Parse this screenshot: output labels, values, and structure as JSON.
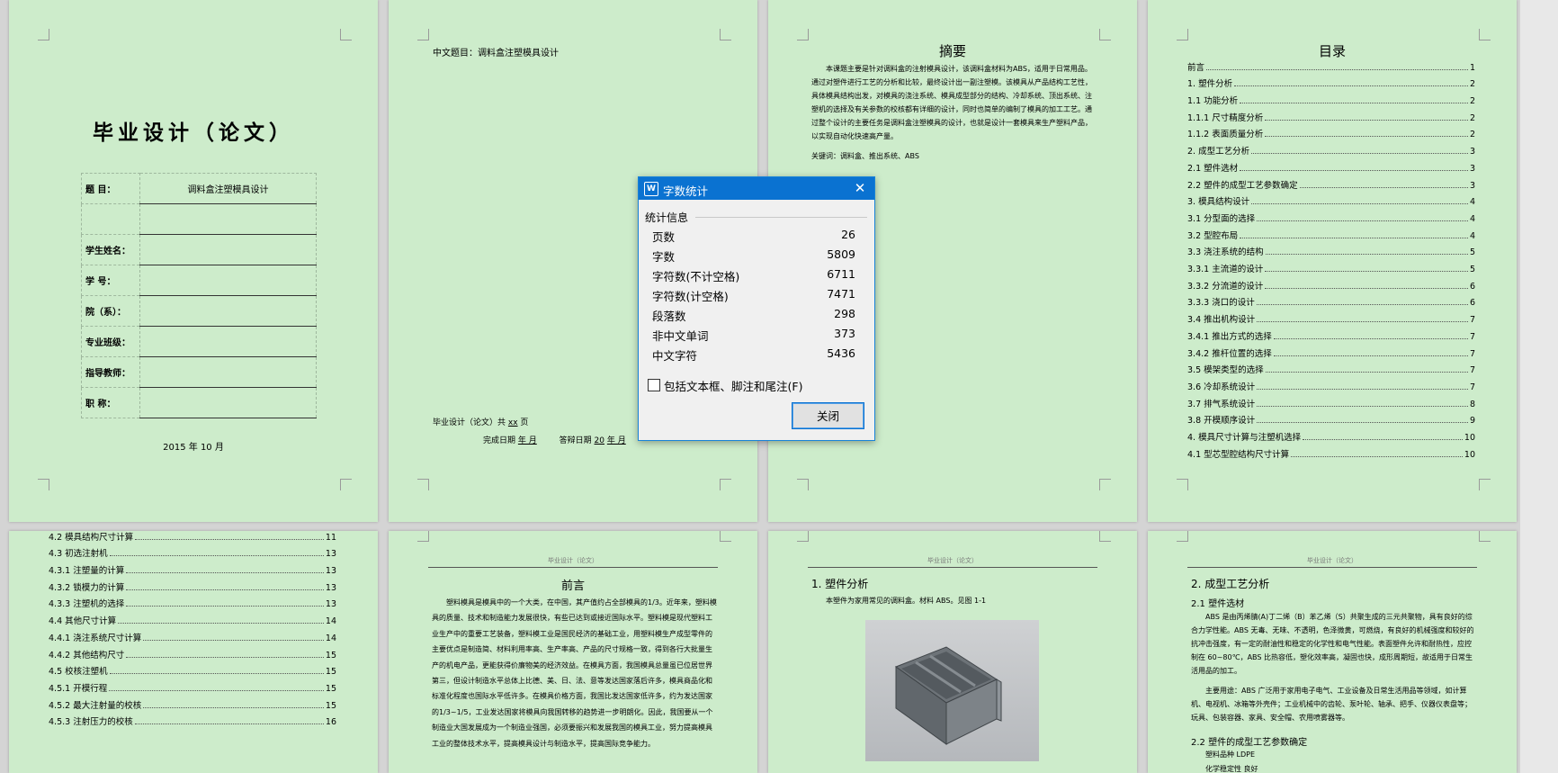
{
  "cover": {
    "title": "毕业设计（论文）",
    "rows": [
      {
        "label": "题    目：",
        "value": "调料盒注塑模具设计"
      },
      {
        "label": "",
        "value": ""
      },
      {
        "label": "学生姓名：",
        "value": ""
      },
      {
        "label": "学    号：",
        "value": ""
      },
      {
        "label": "院（系）：",
        "value": ""
      },
      {
        "label": "专业班级：",
        "value": ""
      },
      {
        "label": "指导教师：",
        "value": ""
      },
      {
        "label": "职    称：",
        "value": ""
      }
    ],
    "date": "2015 年 10 月"
  },
  "page2": {
    "subject": "中文题目：调料盒注塑模具设计",
    "total_prefix": "毕业设计（论文）共",
    "total_blank": "xx",
    "total_suffix": "页",
    "complete_prefix": "完成日期",
    "complete_month": "年  月",
    "defense_prefix": "答辩日期",
    "defense_year": "20",
    "defense_rest": "年  月"
  },
  "abstract": {
    "title": "摘要",
    "body": "本课题主要是针对调料盒的注射模具设计，该调料盒材料为ABS，适用于日常用品。通过对塑件进行工艺的分析和比较，最终设计出一副注塑模。该模具从产品结构工艺性，具体模具结构出发，对模具的浇注系统、模具成型部分的结构、冷却系统、顶出系统、注塑机的选择及有关参数的校核都有详细的设计，同时也简单的编制了模具的加工工艺。通过整个设计的主要任务是调料盒注塑模具的设计，也就是设计一套模具来生产塑料产品，以实现自动化快速高产量。",
    "keywords": "关键词：调料盒、推出系统、ABS"
  },
  "toc": {
    "title": "目录",
    "items": [
      {
        "t": "前言",
        "n": "1"
      },
      {
        "t": "1. 塑件分析",
        "n": "2"
      },
      {
        "t": "1.1 功能分析",
        "n": "2"
      },
      {
        "t": "1.1.1 尺寸精度分析",
        "n": "2"
      },
      {
        "t": "1.1.2 表面质量分析",
        "n": "2"
      },
      {
        "t": "2. 成型工艺分析",
        "n": "3"
      },
      {
        "t": "2.1 塑件选材",
        "n": "3"
      },
      {
        "t": "2.2 塑件的成型工艺参数确定",
        "n": "3"
      },
      {
        "t": "3. 模具结构设计",
        "n": "4"
      },
      {
        "t": "3.1 分型面的选择",
        "n": "4"
      },
      {
        "t": "3.2 型腔布局",
        "n": "4"
      },
      {
        "t": "3.3 浇注系统的结构",
        "n": "5"
      },
      {
        "t": "3.3.1 主流道的设计",
        "n": "5"
      },
      {
        "t": "3.3.2 分流道的设计",
        "n": "6"
      },
      {
        "t": "3.3.3 浇口的设计",
        "n": "6"
      },
      {
        "t": "3.4 推出机构设计",
        "n": "7"
      },
      {
        "t": "3.4.1 推出方式的选择",
        "n": "7"
      },
      {
        "t": "3.4.2 推杆位置的选择",
        "n": "7"
      },
      {
        "t": "3.5 模架类型的选择",
        "n": "7"
      },
      {
        "t": "3.6 冷却系统设计",
        "n": "7"
      },
      {
        "t": "3.7 排气系统设计",
        "n": "8"
      },
      {
        "t": "3.8 开模顺序设计",
        "n": "9"
      },
      {
        "t": "4. 模具尺寸计算与注塑机选择",
        "n": "10"
      },
      {
        "t": "4.1 型芯型腔结构尺寸计算",
        "n": "10"
      }
    ]
  },
  "toc2": {
    "items": [
      {
        "t": "4.2 模具结构尺寸计算",
        "n": "11"
      },
      {
        "t": "4.3 初选注射机",
        "n": "13"
      },
      {
        "t": "4.3.1 注塑量的计算",
        "n": "13"
      },
      {
        "t": "4.3.2 锁模力的计算",
        "n": "13"
      },
      {
        "t": "4.3.3 注塑机的选择",
        "n": "13"
      },
      {
        "t": "4.4 其他尺寸计算",
        "n": "14"
      },
      {
        "t": "4.4.1 浇注系统尺寸计算",
        "n": "14"
      },
      {
        "t": "4.4.2 其他结构尺寸",
        "n": "15"
      },
      {
        "t": "4.5 校核注塑机",
        "n": "15"
      },
      {
        "t": "4.5.1 开模行程",
        "n": "15"
      },
      {
        "t": "4.5.2 最大注射量的校核",
        "n": "15"
      },
      {
        "t": "4.5.3 注射压力的校核",
        "n": "16"
      }
    ]
  },
  "header_text": "毕业设计（论文）",
  "preface": {
    "title": "前言",
    "body": "塑料模具是模具中的一个大类，在中国，其产值约占全部模具的1/3。近年来，塑料模具的质量、技术和制造能力发展很快，有些已达到或接近国际水平。塑料模是现代塑料工业生产中的重要工艺装备，塑料模工业是国民经济的基础工业，用塑料模生产成型零件的主要优点是制造简、材料利用率高、生产率高、产品的尺寸规格一致，得到各行大批量生产的机电产品，更能获得价廉物美的经济效益。在模具方面，我国模具总量虽已位居世界第三，但设计制造水平总体上比德、美、日、法、意等发达国家落后许多，模具商品化和标准化程度也国际水平低许多。在模具价格方面，我国比发达国家低许多，约为发达国家的1/3~1/5，工业发达国家将模具向我国转移的趋势进一步明朗化。因此，我国要从一个制造业大国发展成为一个制造业强国，必须要振兴和发展我国的模具工业，努力提高模具工业的整体技术水平，提高模具设计与制造水平，提高国际竞争能力。"
  },
  "part1": {
    "title": "1. 塑件分析",
    "line": "本塑件为家用常见的调料盒。材料 ABS。见图 1-1"
  },
  "part2": {
    "title": "2. 成型工艺分析",
    "sub1": "2.1 塑件选材",
    "para1": "ABS 是由丙烯腈(A)丁二烯（B）苯乙烯（S）共聚生成的三元共聚物，具有良好的综合力学性能。ABS 无毒、无味、不透明，色泽微黄，可燃烧，有良好的机械强度和较好的抗冲击强度，有一定的耐油性和稳定的化学性和电气性能。表面塑件允许和耐热性，应控制在 60~80℃，ABS 比热容低，塑化效率高，凝固也快，成形周期短，故适用于日常生活用品的加工。",
    "para2": "主要用途：ABS 广泛用于家用电子电气、工业设备及日常生活用品等领域，如计算机、电视机、冰箱等外壳件；工业机械中的齿轮、泵叶轮、轴承、把手、仪器仪表盘等；玩具、包装容器、家具、安全帽、农用喷雾器等。",
    "sub2": "2.2 塑件的成型工艺参数确定",
    "line1": "塑料品种 LDPE",
    "line2": "化学稳定性 良好"
  },
  "dialog": {
    "title": "字数统计",
    "icon_letter": "W",
    "section": "统计信息",
    "stats": [
      {
        "label": "页数",
        "value": "26"
      },
      {
        "label": "字数",
        "value": "5809"
      },
      {
        "label": "字符数(不计空格)",
        "value": "6711"
      },
      {
        "label": "字符数(计空格)",
        "value": "7471"
      },
      {
        "label": "段落数",
        "value": "298"
      },
      {
        "label": "非中文单词",
        "value": "373"
      },
      {
        "label": "中文字符",
        "value": "5436"
      }
    ],
    "checkbox_label": "包括文本框、脚注和尾注(F)",
    "close_label": "关闭",
    "close_glyph": "✕"
  },
  "colors": {
    "page_bg": "#cdeccb",
    "dialog_title_bg": "#0a72d1",
    "dialog_border": "#1883d7"
  }
}
